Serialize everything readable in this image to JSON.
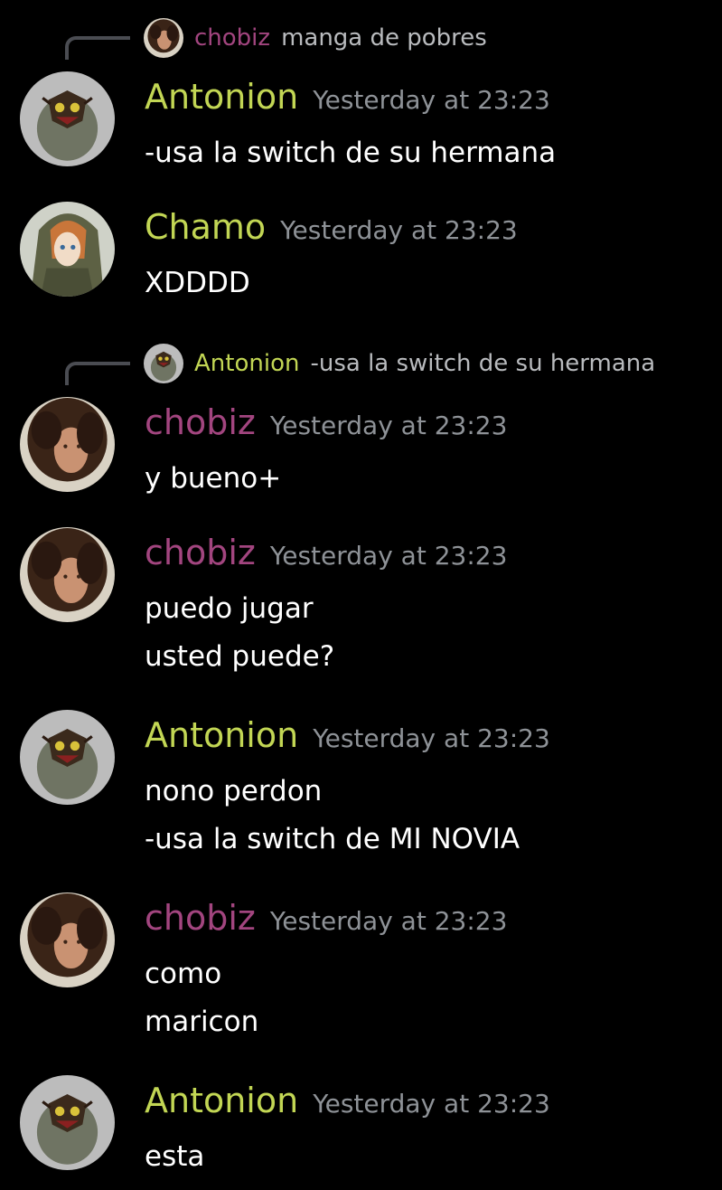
{
  "colors": {
    "antonion": "#c2d654",
    "chamo": "#c2d654",
    "chobiz": "#a2457f",
    "timestamp": "#8e9297",
    "reply_text": "#b9bbbe",
    "background": "#000000"
  },
  "messages": [
    {
      "reply": {
        "author": "chobiz",
        "text": "manga de pobres"
      },
      "author": "Antonion",
      "time": "Yesterday at 23:23",
      "lines": [
        "-usa la switch de su hermana"
      ]
    },
    {
      "author": "Chamo",
      "time": "Yesterday at 23:23",
      "lines": [
        "XDDDD"
      ]
    },
    {
      "reply": {
        "author": "Antonion",
        "text": "-usa la switch de su hermana"
      },
      "author": "chobiz",
      "time": "Yesterday at 23:23",
      "lines": [
        "y bueno+"
      ]
    },
    {
      "author": "chobiz",
      "time": "Yesterday at 23:23",
      "lines": [
        "puedo jugar",
        "usted puede?"
      ]
    },
    {
      "author": "Antonion",
      "time": "Yesterday at 23:23",
      "lines": [
        "nono perdon",
        "-usa la switch de MI NOVIA"
      ]
    },
    {
      "author": "chobiz",
      "time": "Yesterday at 23:23",
      "lines": [
        "como",
        "maricon"
      ]
    },
    {
      "author": "Antonion",
      "time": "Yesterday at 23:23",
      "lines": [
        "esta"
      ]
    }
  ]
}
